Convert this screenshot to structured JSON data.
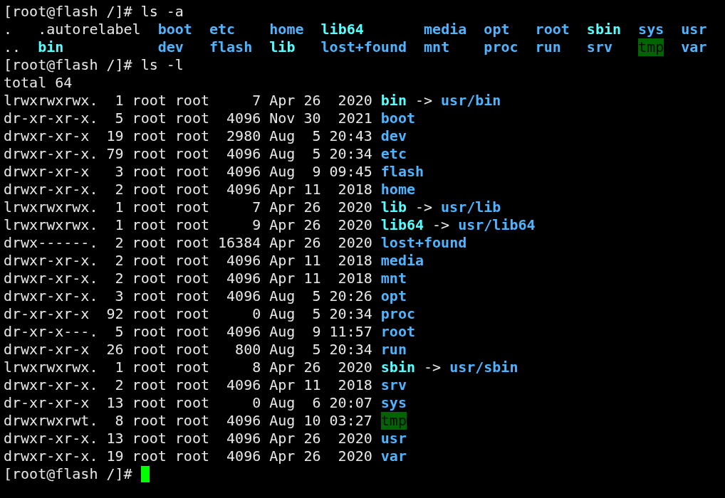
{
  "prompt_1": {
    "prompt": "[root@flash /]#",
    "command": "ls -a"
  },
  "ls_a_entries": [
    {
      "name": ".",
      "kind": "file"
    },
    {
      "name": "..",
      "kind": "file"
    },
    {
      "name": ".autorelabel",
      "kind": "file"
    },
    {
      "name": "bin",
      "kind": "link"
    },
    {
      "name": "boot",
      "kind": "dir"
    },
    {
      "name": "dev",
      "kind": "dir"
    },
    {
      "name": "etc",
      "kind": "dir"
    },
    {
      "name": "flash",
      "kind": "dir"
    },
    {
      "name": "home",
      "kind": "dir"
    },
    {
      "name": "lib",
      "kind": "link"
    },
    {
      "name": "lib64",
      "kind": "link"
    },
    {
      "name": "lost+found",
      "kind": "dir"
    },
    {
      "name": "media",
      "kind": "dir"
    },
    {
      "name": "mnt",
      "kind": "dir"
    },
    {
      "name": "opt",
      "kind": "dir"
    },
    {
      "name": "proc",
      "kind": "dir"
    },
    {
      "name": "root",
      "kind": "dir"
    },
    {
      "name": "run",
      "kind": "dir"
    },
    {
      "name": "sbin",
      "kind": "link"
    },
    {
      "name": "srv",
      "kind": "dir"
    },
    {
      "name": "sys",
      "kind": "dir"
    },
    {
      "name": "tmp",
      "kind": "sticky"
    },
    {
      "name": "usr",
      "kind": "dir"
    },
    {
      "name": "var",
      "kind": "dir"
    }
  ],
  "prompt_2": {
    "prompt": "[root@flash /]#",
    "command": "ls -l"
  },
  "total": "total 64",
  "ls_l_rows": [
    {
      "details": "lrwxrwxrwx.  1 root root     7 Apr 26  2020",
      "name": "bin",
      "kind": "link",
      "arrow": "->",
      "target": "usr/bin"
    },
    {
      "details": "dr-xr-xr-x.  5 root root  4096 Nov 30  2021",
      "name": "boot",
      "kind": "dir"
    },
    {
      "details": "drwxr-xr-x  19 root root  2980 Aug  5 20:43",
      "name": "dev",
      "kind": "dir"
    },
    {
      "details": "drwxr-xr-x. 79 root root  4096 Aug  5 20:34",
      "name": "etc",
      "kind": "dir"
    },
    {
      "details": "drwxr-xr-x   3 root root  4096 Aug  9 09:45",
      "name": "flash",
      "kind": "dir"
    },
    {
      "details": "drwxr-xr-x.  2 root root  4096 Apr 11  2018",
      "name": "home",
      "kind": "dir"
    },
    {
      "details": "lrwxrwxrwx.  1 root root     7 Apr 26  2020",
      "name": "lib",
      "kind": "link",
      "arrow": "->",
      "target": "usr/lib"
    },
    {
      "details": "lrwxrwxrwx.  1 root root     9 Apr 26  2020",
      "name": "lib64",
      "kind": "link",
      "arrow": "->",
      "target": "usr/lib64"
    },
    {
      "details": "drwx------.  2 root root 16384 Apr 26  2020",
      "name": "lost+found",
      "kind": "dir"
    },
    {
      "details": "drwxr-xr-x.  2 root root  4096 Apr 11  2018",
      "name": "media",
      "kind": "dir"
    },
    {
      "details": "drwxr-xr-x.  2 root root  4096 Apr 11  2018",
      "name": "mnt",
      "kind": "dir"
    },
    {
      "details": "drwxr-xr-x.  3 root root  4096 Aug  5 20:26",
      "name": "opt",
      "kind": "dir"
    },
    {
      "details": "dr-xr-xr-x  92 root root     0 Aug  5 20:34",
      "name": "proc",
      "kind": "dir"
    },
    {
      "details": "dr-xr-x---.  5 root root  4096 Aug  9 11:57",
      "name": "root",
      "kind": "dir"
    },
    {
      "details": "drwxr-xr-x  26 root root   800 Aug  5 20:34",
      "name": "run",
      "kind": "dir"
    },
    {
      "details": "lrwxrwxrwx.  1 root root     8 Apr 26  2020",
      "name": "sbin",
      "kind": "link",
      "arrow": "->",
      "target": "usr/sbin"
    },
    {
      "details": "drwxr-xr-x.  2 root root  4096 Apr 11  2018",
      "name": "srv",
      "kind": "dir"
    },
    {
      "details": "dr-xr-xr-x  13 root root     0 Aug  6 20:07",
      "name": "sys",
      "kind": "dir"
    },
    {
      "details": "drwxrwxrwt.  8 root root  4096 Aug 10 03:27",
      "name": "tmp",
      "kind": "sticky"
    },
    {
      "details": "drwxr-xr-x. 13 root root  4096 Apr 26  2020",
      "name": "usr",
      "kind": "dir"
    },
    {
      "details": "drwxr-xr-x. 19 root root  4096 Apr 26  2020",
      "name": "var",
      "kind": "dir"
    }
  ],
  "prompt_3": {
    "prompt": "[root@flash /]#",
    "cursor_visible": true
  }
}
